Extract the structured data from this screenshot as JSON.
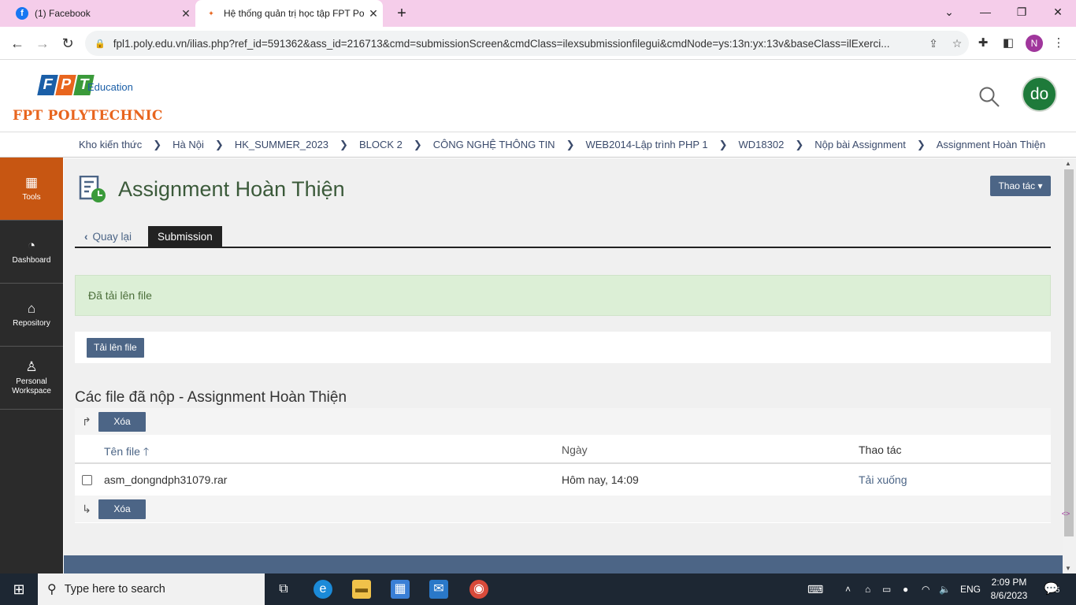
{
  "browser": {
    "tabs": [
      {
        "title": "(1) Facebook",
        "active": false
      },
      {
        "title": "Hệ thống quản trị học tập FPT Po",
        "active": true
      }
    ],
    "url": "fpl1.poly.edu.vn/ilias.php?ref_id=591362&ass_id=216713&cmd=submissionScreen&cmdClass=ilexsubmissionfilegui&cmdNode=ys:13n:yx:13v&baseClass=ilExerci...",
    "profile_initial": "N"
  },
  "header": {
    "logo_letters": [
      "F",
      "P",
      "T"
    ],
    "logo_education": "Education",
    "logo_name": "FPT POLYTECHNIC",
    "avatar_initials": "do"
  },
  "breadcrumbs": [
    "Kho kiến thức",
    "Hà Nội",
    "HK_SUMMER_2023",
    "BLOCK 2",
    "CÔNG NGHỆ THÔNG TIN",
    "WEB2014-Lập trình PHP 1",
    "WD18302",
    "Nộp bài Assignment",
    "Assignment Hoàn Thiện"
  ],
  "mainbar": [
    {
      "label": "Tools",
      "icon": "grid-icon",
      "active": true
    },
    {
      "label": "Dashboard",
      "icon": "dashboard-icon",
      "active": false
    },
    {
      "label": "Repository",
      "icon": "repository-icon",
      "active": false
    },
    {
      "label": "Personal Workspace",
      "icon": "user-icon",
      "active": false
    }
  ],
  "content": {
    "title": "Assignment Hoàn Thiện",
    "actions_label": "Thao tác",
    "back_label": "Quay lại",
    "active_tab": "Submission",
    "success_message": "Đã tải lên file",
    "upload_button": "Tải lên file",
    "section_title": "Các file đã nộp - Assignment Hoàn Thiện",
    "delete_label": "Xóa",
    "columns": [
      "Tên file",
      "Ngày",
      "Thao tác"
    ],
    "rows": [
      {
        "filename": "asm_dongndph31079.rar",
        "date": "Hôm nay, 14:09",
        "action": "Tải xuống"
      }
    ]
  },
  "taskbar": {
    "search_placeholder": "Type here to search",
    "language": "ENG",
    "time": "2:09 PM",
    "date": "8/6/2023",
    "notification_count": "5"
  },
  "colors": {
    "tab_strip": "#f5cdea",
    "mainbar_active": "#c75612",
    "button_blue": "#4c6586",
    "success_bg": "#dcefd6",
    "logo_orange": "#e8651e"
  }
}
